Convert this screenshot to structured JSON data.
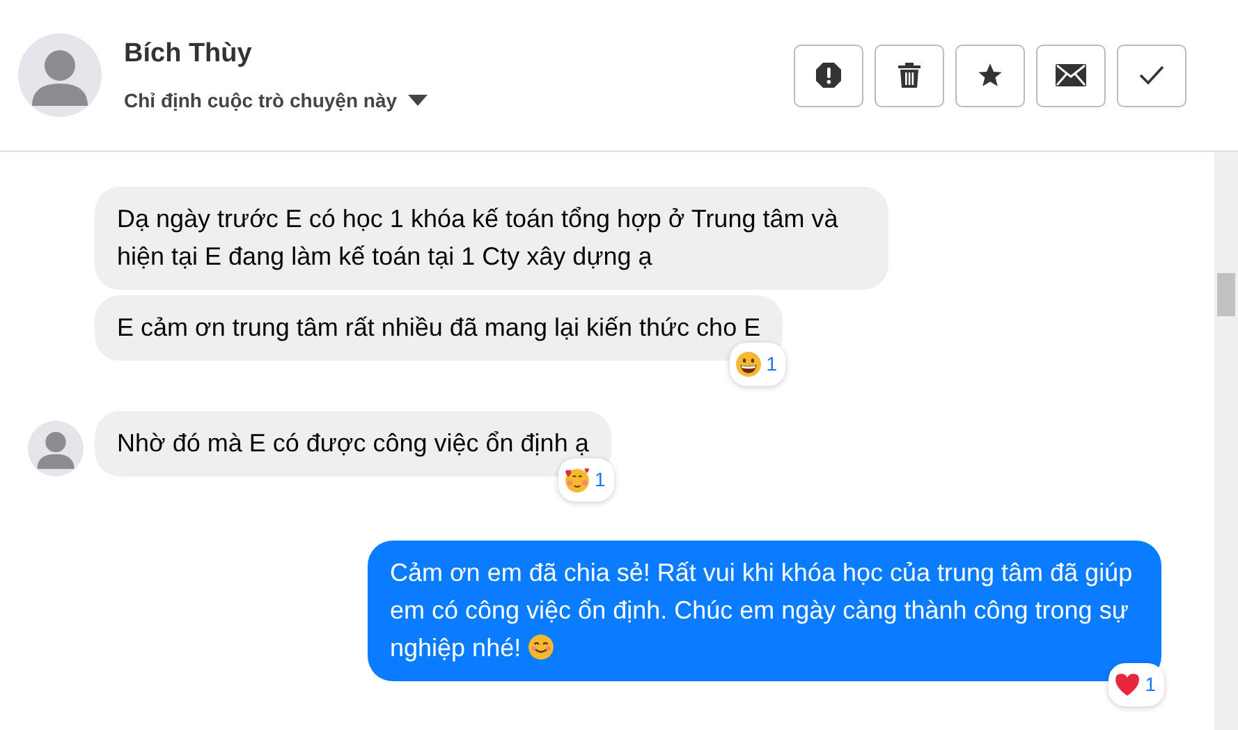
{
  "header": {
    "name": "Bích Thùy",
    "subtitle": "Chỉ định cuộc trò chuyện này",
    "actions": [
      {
        "kind": "report"
      },
      {
        "kind": "delete"
      },
      {
        "kind": "star"
      },
      {
        "kind": "mail"
      },
      {
        "kind": "done"
      }
    ]
  },
  "messages": [
    {
      "kind": "incoming",
      "text": "Dạ ngày trước E có học 1 khóa kế toán tổng hợp ở Trung tâm và hiện tại E đang làm kế toán tại 1 Cty xây dựng ạ",
      "avatar": false
    },
    {
      "kind": "incoming",
      "text": "E cảm ơn trung tâm rất nhiều đã mang lại kiến thức cho E",
      "avatar": false,
      "reaction": {
        "kind": "grin",
        "count": "1"
      }
    },
    {
      "kind": "incoming",
      "text": "Nhờ đó mà E có được công việc ổn định ạ",
      "avatar": true,
      "reaction": {
        "kind": "love",
        "count": "1"
      }
    },
    {
      "kind": "outgoing",
      "text": "Cảm ơn em đã chia sẻ! Rất vui khi khóa học của trung tâm đã giúp em có công việc ổn định. Chúc em ngày càng thành công trong sự nghiệp nhé!",
      "smiley": true,
      "reaction": {
        "kind": "heart",
        "count": "1"
      }
    }
  ]
}
